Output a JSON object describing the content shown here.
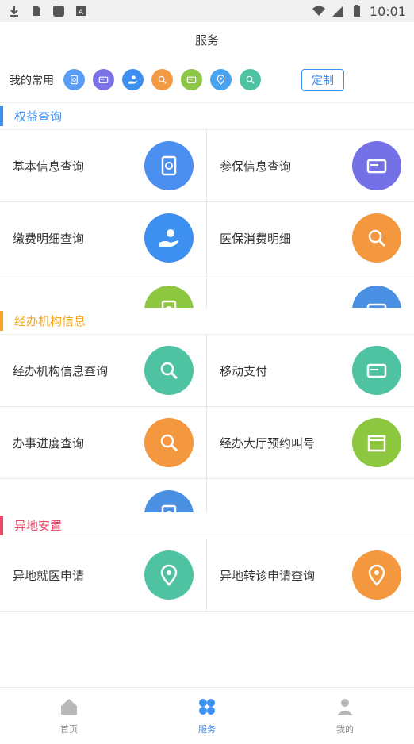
{
  "status": {
    "time": "10:01"
  },
  "header": {
    "title": "服务"
  },
  "favorites": {
    "label": "我的常用",
    "custom_label": "定制",
    "icons": [
      {
        "name": "document-icon",
        "color": "#5b9cf5"
      },
      {
        "name": "id-card-icon",
        "color": "#7a73e8"
      },
      {
        "name": "hand-money-icon",
        "color": "#3d8ff0"
      },
      {
        "name": "card-search-icon",
        "color": "#f39a45"
      },
      {
        "name": "card-icon",
        "color": "#8cc646"
      },
      {
        "name": "location-icon",
        "color": "#4aa3ef"
      },
      {
        "name": "magnify-icon",
        "color": "#4fc3a1"
      }
    ]
  },
  "sections": [
    {
      "title": "权益查询",
      "color": "#3d8ff0",
      "items": [
        {
          "label": "基本信息查询",
          "color": "#4a8ef0"
        },
        {
          "label": "参保信息查询",
          "color": "#7470e6"
        },
        {
          "label": "缴费明细查询",
          "color": "#3d8ff0"
        },
        {
          "label": "医保消费明细",
          "color": "#f3983f"
        },
        {
          "label": "",
          "color": "#8dc63f"
        },
        {
          "label": "",
          "color": "#4a90e2"
        }
      ]
    },
    {
      "title": "经办机构信息",
      "color": "#f5a623",
      "items": [
        {
          "label": "经办机构信息查询",
          "color": "#4fc3a1"
        },
        {
          "label": "移动支付",
          "color": "#4fc3a1"
        },
        {
          "label": "办事进度查询",
          "color": "#f3983f"
        },
        {
          "label": "经办大厅预约叫号",
          "color": "#8dc63f"
        },
        {
          "label": "",
          "color": "#4a90e2"
        },
        {
          "label": "",
          "color": ""
        }
      ]
    },
    {
      "title": "异地安置",
      "color": "#e84a6a",
      "items": [
        {
          "label": "异地就医申请",
          "color": "#4fc3a1"
        },
        {
          "label": "异地转诊申请查询",
          "color": "#f3983f"
        }
      ]
    }
  ],
  "tabbar": [
    {
      "label": "首页",
      "icon": "home-icon"
    },
    {
      "label": "服务",
      "icon": "grid-icon",
      "active": true
    },
    {
      "label": "我的",
      "icon": "user-icon"
    }
  ]
}
